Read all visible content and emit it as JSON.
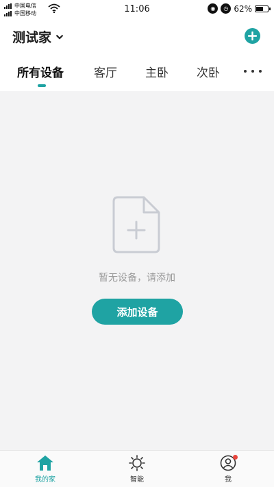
{
  "status_bar": {
    "carrier_1": "中国电信",
    "carrier_2": "中国移动",
    "time": "11:06",
    "battery": "62%",
    "battery_level": 0.62
  },
  "header": {
    "home_name": "测试家"
  },
  "tabs": [
    {
      "label": "所有设备",
      "active": true
    },
    {
      "label": "客厅",
      "active": false
    },
    {
      "label": "主卧",
      "active": false
    },
    {
      "label": "次卧",
      "active": false
    }
  ],
  "empty_state": {
    "message": "暂无设备，请添加",
    "button_label": "添加设备"
  },
  "bottom_nav": [
    {
      "label": "我的家",
      "icon": "home-icon",
      "active": true
    },
    {
      "label": "智能",
      "icon": "sun-icon",
      "active": false
    },
    {
      "label": "我",
      "icon": "user-icon",
      "active": false,
      "badge": true
    }
  ],
  "colors": {
    "accent": "#1fa3a3",
    "background": "#f3f3f4",
    "badge": "#e8453c"
  }
}
